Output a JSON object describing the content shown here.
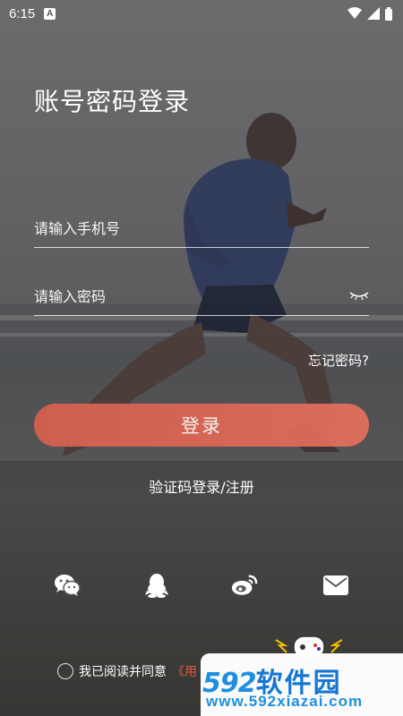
{
  "status_bar": {
    "time": "6:15",
    "badge": "A"
  },
  "title": "账号密码登录",
  "phone_field": {
    "placeholder": "请输入手机号",
    "value": ""
  },
  "password_field": {
    "placeholder": "请输入密码",
    "value": ""
  },
  "forgot_password": "忘记密码?",
  "login_button": "登录",
  "code_login": "验证码登录/注册",
  "social": [
    "wechat-icon",
    "qq-icon",
    "weibo-icon",
    "mail-icon"
  ],
  "agreement": {
    "text": "我已阅读并同意",
    "terms": "《用"
  },
  "watermark": {
    "logo_digits": "592",
    "logo_cn": "软件园",
    "url": "www.592xiazai.com"
  },
  "colors": {
    "accent": "#e0604e",
    "terms": "#e05a44",
    "watermark_blue": "#1e8fe0"
  }
}
